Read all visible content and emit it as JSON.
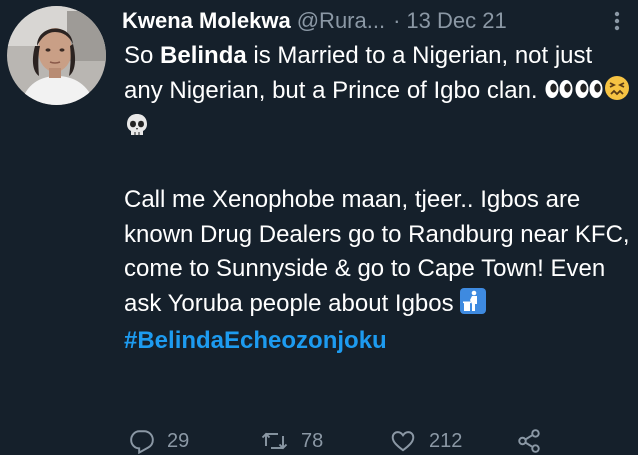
{
  "author": {
    "name": "Kwena Molekwa",
    "handle": "@Rura...",
    "separator": "·",
    "date": "13 Dec 21"
  },
  "tweet": {
    "line1_prefix": "So ",
    "line1_bold": "Belinda",
    "line1_suffix": " is Married to a Nigerian, not just any Nigerian, but a Prince of Igbo clan.",
    "paragraph2": "Call me Xenophobe maan, tjeer.. Igbos are known Drug Dealers go to Randburg near KFC, come to Sunnyside & go to Cape Town! Even ask Yoruba people about Igbos",
    "hashtag": "#BelindaEcheozonjoku"
  },
  "icons": {
    "more": "more-vertical-icon",
    "eyes": "eyes-emoji",
    "confounded": "confounded-face-emoji",
    "skull": "skull-emoji",
    "litter": "put-litter-in-its-place-emoji",
    "reply": "reply-icon",
    "retweet": "retweet-icon",
    "like": "heart-icon",
    "share": "share-icon"
  },
  "stats": {
    "replies": "29",
    "retweets": "78",
    "likes": "212"
  },
  "colors": {
    "background": "#15202b",
    "text": "#ffffff",
    "secondary": "#8b98a5",
    "link": "#1d9bf0"
  }
}
